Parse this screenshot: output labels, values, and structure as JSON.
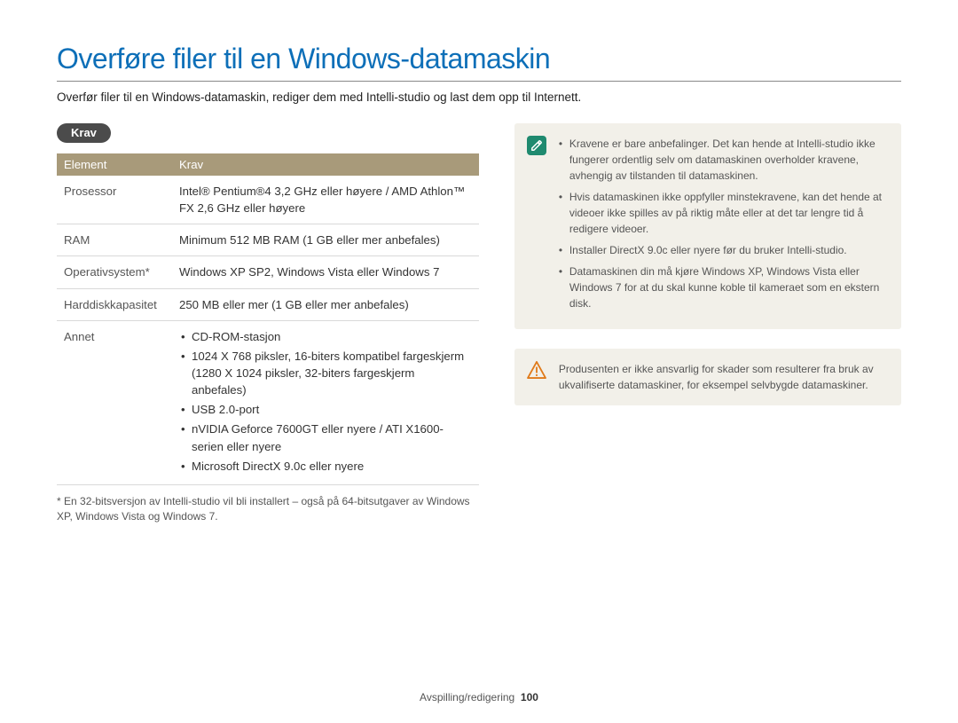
{
  "title": "Overføre filer til en Windows-datamaskin",
  "intro": "Overfør filer til en Windows-datamaskin, rediger dem med Intelli-studio og last dem opp til Internett.",
  "section_label": "Krav",
  "table": {
    "headers": {
      "element": "Element",
      "krav": "Krav"
    },
    "rows": [
      {
        "label": "Prosessor",
        "value": "Intel® Pentium®4 3,2 GHz eller høyere / AMD Athlon™ FX 2,6 GHz eller høyere"
      },
      {
        "label": "RAM",
        "value": "Minimum 512 MB RAM (1 GB eller mer anbefales)"
      },
      {
        "label": "Operativsystem*",
        "value": "Windows XP SP2, Windows Vista eller Windows 7"
      },
      {
        "label": "Harddiskkapasitet",
        "value": "250 MB eller mer (1 GB eller mer anbefales)"
      }
    ],
    "annet_label": "Annet",
    "annet_items": [
      "CD-ROM-stasjon",
      "1024 X 768 piksler, 16-biters kompatibel fargeskjerm (1280 X 1024 piksler, 32-biters fargeskjerm anbefales)",
      "USB 2.0-port",
      "nVIDIA Geforce 7600GT eller nyere / ATI X1600-serien eller nyere",
      "Microsoft DirectX 9.0c eller nyere"
    ]
  },
  "footnote": "* En 32-bitsversjon av Intelli-studio vil bli installert – også på 64-bitsutgaver av Windows XP, Windows Vista og Windows 7.",
  "info_notes": [
    "Kravene er bare anbefalinger. Det kan hende at Intelli-studio ikke fungerer ordentlig selv om datamaskinen overholder kravene, avhengig av tilstanden til datamaskinen.",
    "Hvis datamaskinen ikke oppfyller minstekravene, kan det hende at videoer ikke spilles av på riktig måte eller at det tar lengre tid å redigere videoer.",
    "Installer DirectX 9.0c eller nyere før du bruker Intelli-studio.",
    "Datamaskinen din må kjøre Windows XP, Windows Vista eller Windows 7 for at du skal kunne koble til kameraet som en ekstern disk."
  ],
  "warn_note": "Produsenten er ikke ansvarlig for skader som resulterer fra bruk av ukvalifiserte datamaskiner, for eksempel selvbygde datamaskiner.",
  "footer": {
    "section": "Avspilling/redigering",
    "page": "100"
  },
  "icons": {
    "info_glyph": "✎",
    "warn_glyph": "!"
  }
}
